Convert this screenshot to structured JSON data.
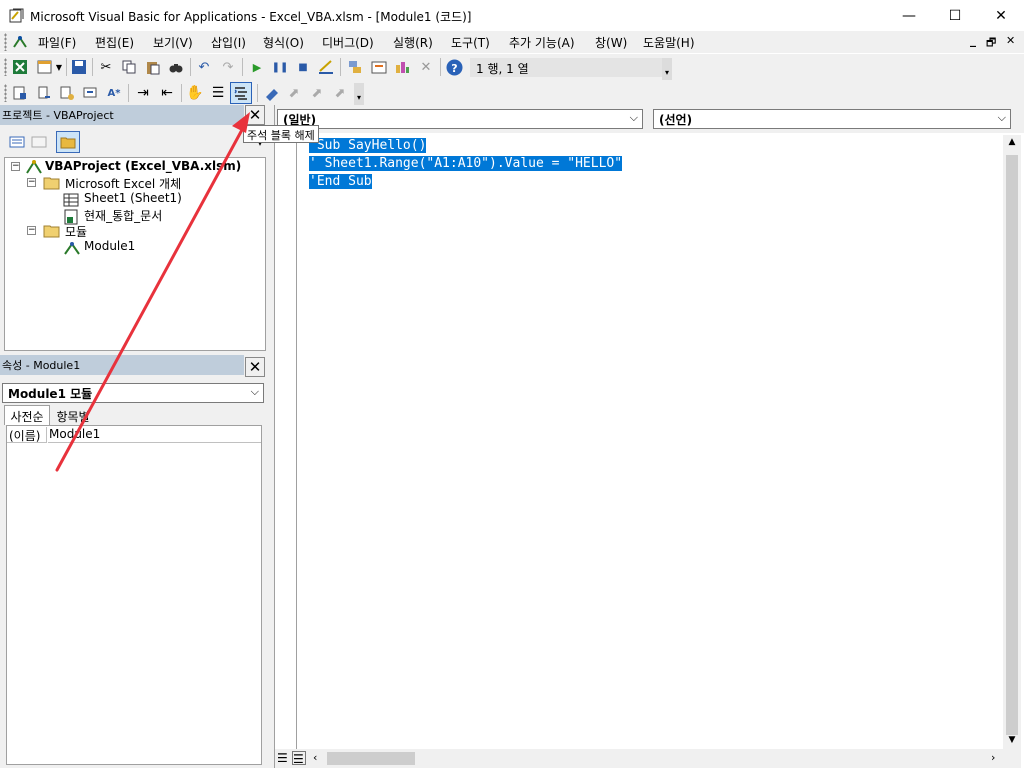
{
  "window": {
    "title": "Microsoft Visual Basic for Applications - Excel_VBA.xlsm - [Module1 (코드)]",
    "minimize": "—",
    "maximize": "☐",
    "close": "✕"
  },
  "menu": {
    "items": [
      "파일(F)",
      "편집(E)",
      "보기(V)",
      "삽입(I)",
      "형식(O)",
      "디버그(D)",
      "실행(R)",
      "도구(T)",
      "추가 기능(A)",
      "창(W)",
      "도움말(H)"
    ],
    "doc_min": "_",
    "doc_restore": "🗗",
    "doc_close": "✕"
  },
  "toolbar": {
    "position_label": "1 행, 1 열",
    "tooltip": "주석 블록 해제"
  },
  "project_pane": {
    "title": "프로젝트 - VBAProject",
    "close": "✕",
    "tree": {
      "root": "VBAProject (Excel_VBA.xlsm)",
      "excel_objects": "Microsoft Excel 개체",
      "sheet1": "Sheet1 (Sheet1)",
      "workbook": "현재_통합_문서",
      "modules": "모듈",
      "module1": "Module1"
    }
  },
  "properties_pane": {
    "title": "속성 - Module1",
    "close": "✕",
    "object_combo": "Module1 모듈",
    "tab_alpha": "사전순",
    "tab_category": "항목별",
    "prop_name": "(이름)",
    "prop_value": "Module1"
  },
  "code_pane": {
    "object_combo": "(일반)",
    "proc_combo": "(선언)",
    "lines": [
      "'Sub SayHello()",
      "'    Sheet1.Range(\"A1:A10\").Value = \"HELLO\"",
      "'End Sub"
    ]
  },
  "colors": {
    "selection": "#0078d7",
    "annotation_arrow": "#e8323c",
    "pane_title": "#bfcddb"
  }
}
